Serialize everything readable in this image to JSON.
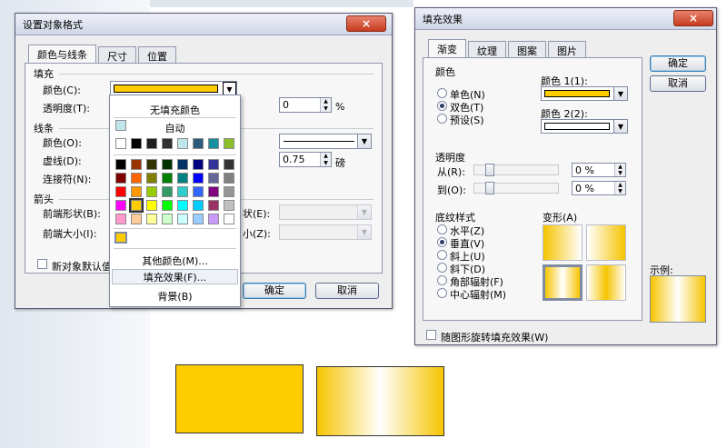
{
  "colors": {
    "accent_fill": "#ffcc00",
    "title_bar_close": "#c73b1f"
  },
  "format_dialog": {
    "title": "设置对象格式",
    "close_icon": "×",
    "tabs": [
      "颜色与线条",
      "尺寸",
      "位置"
    ],
    "fill": {
      "section": "填充",
      "color_label": "颜色(C):",
      "transparency_label": "透明度(T):",
      "transparency_value": "0",
      "percent": "%"
    },
    "line": {
      "section": "线条",
      "color_label": "颜色(O):",
      "dash_label": "虚线(D):",
      "connector_label": "连接符(N):",
      "weight_value": "0.75",
      "weight_unit": "磅"
    },
    "arrows": {
      "section": "箭头",
      "begin_style_label": "前端形状(B):",
      "begin_size_label": "前端大小(I):",
      "end_style_label_partial": "状(E):",
      "end_size_label_partial": "小(Z):"
    },
    "default_checkbox_label": "新对象默认值",
    "ok_label": "确定",
    "cancel_label": "取消"
  },
  "color_dropdown": {
    "no_fill": "无填充颜色",
    "automatic": "自动",
    "more_colors": "其他颜色(M)...",
    "fill_effects": "填充效果(F)...",
    "background": "背景(B)",
    "row1": [
      "#ffffff",
      "#000000",
      "#1f1f1f",
      "#2f2f2f",
      "#bfe6ea",
      "#2e5a7c",
      "#178f9f",
      "#8dbf2a"
    ],
    "palette": [
      [
        "#000000",
        "#993300",
        "#333300",
        "#003300",
        "#003366",
        "#000080",
        "#333399",
        "#333333"
      ],
      [
        "#800000",
        "#ff6600",
        "#808000",
        "#008000",
        "#008080",
        "#0000ff",
        "#666699",
        "#808080"
      ],
      [
        "#ff0000",
        "#ff9900",
        "#99cc00",
        "#339966",
        "#33cccc",
        "#3366ff",
        "#800080",
        "#969696"
      ],
      [
        "#ff00ff",
        "#ffcc00",
        "#ffff00",
        "#00ff00",
        "#00ffff",
        "#00ccff",
        "#993366",
        "#c0c0c0"
      ],
      [
        "#ff99cc",
        "#ffcc99",
        "#ffff99",
        "#ccffcc",
        "#ccffff",
        "#99ccff",
        "#cc99ff",
        "#ffffff"
      ]
    ],
    "recent": "#ffcc00"
  },
  "fill_effects_dialog": {
    "title": "填充效果",
    "close_icon": "×",
    "tabs": [
      "渐变",
      "纹理",
      "图案",
      "图片"
    ],
    "colors_section": "颜色",
    "radio_one": "单色(N)",
    "radio_two": "双色(T)",
    "radio_preset": "预设(S)",
    "color1_label": "颜色 1(1):",
    "color2_label": "颜色 2(2):",
    "color1": "#ffcc00",
    "color2": "#ffffff",
    "transparency_section": "透明度",
    "from_label": "从(R):",
    "to_label": "到(O):",
    "from_value": "0 %",
    "to_value": "0 %",
    "shading_section": "底纹样式",
    "shading_options": [
      "水平(Z)",
      "垂直(V)",
      "斜上(U)",
      "斜下(D)",
      "角部辐射(F)",
      "中心辐射(M)"
    ],
    "shading_selected": 1,
    "variants_label": "变形(A)",
    "sample_label": "示例:",
    "rotate_label": "随图形旋转填充效果(W)",
    "ok_label": "确定",
    "cancel_label": "取消"
  }
}
